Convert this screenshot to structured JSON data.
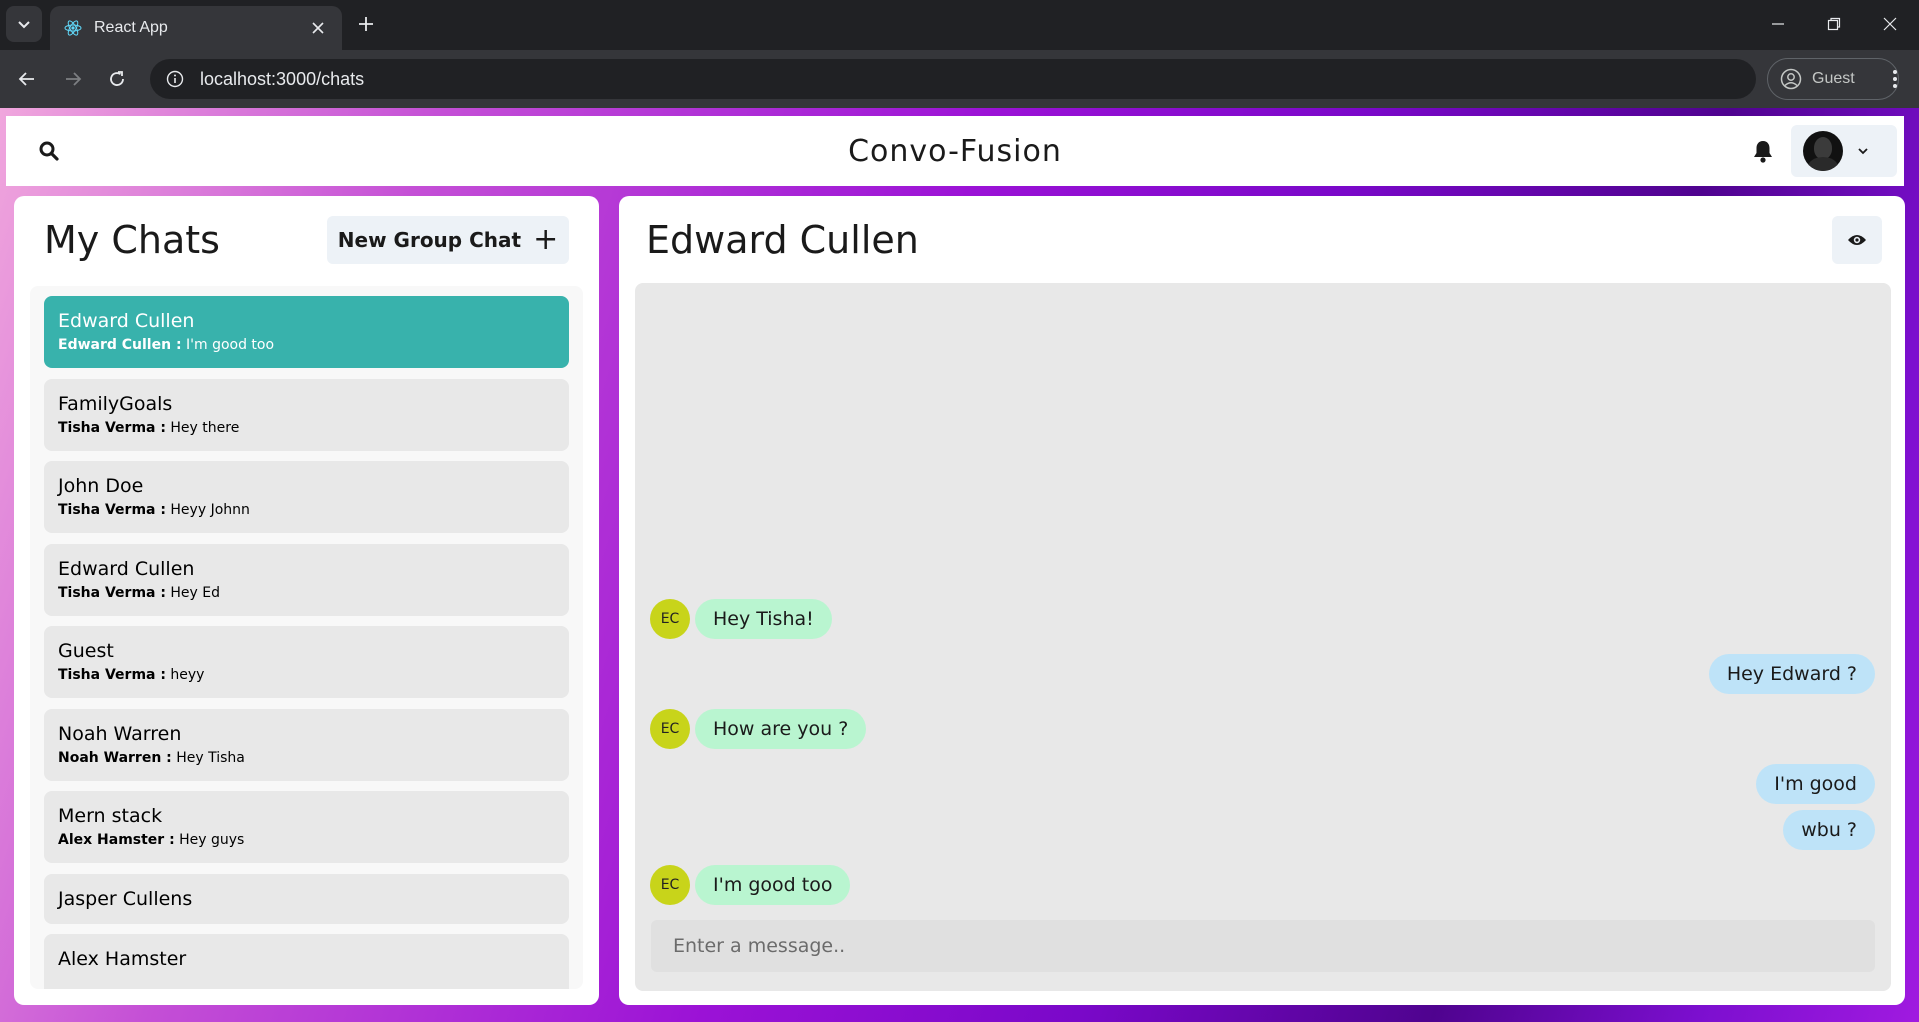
{
  "browser": {
    "tab_title": "React App",
    "url": "localhost:3000/chats",
    "profile_label": "Guest"
  },
  "app": {
    "title": "Convo-Fusion"
  },
  "sidebar": {
    "title": "My Chats",
    "new_group_label": "New Group Chat",
    "new_group_icon": "+",
    "chats": [
      {
        "name": "Edward Cullen",
        "sender": "Edward Cullen :",
        "message": "I'm good too",
        "active": true
      },
      {
        "name": "FamilyGoals",
        "sender": "Tisha Verma :",
        "message": "Hey there"
      },
      {
        "name": "John Doe",
        "sender": "Tisha Verma :",
        "message": "Heyy Johnn"
      },
      {
        "name": "Edward Cullen",
        "sender": "Tisha Verma :",
        "message": "Hey Ed"
      },
      {
        "name": "Guest",
        "sender": "Tisha Verma :",
        "message": "heyy"
      },
      {
        "name": "Noah Warren",
        "sender": "Noah Warren :",
        "message": "Hey Tisha"
      },
      {
        "name": "Mern stack",
        "sender": "Alex Hamster :",
        "message": "Hey guys"
      },
      {
        "name": "Jasper Cullens"
      },
      {
        "name": "Alex Hamster"
      }
    ]
  },
  "chat": {
    "title": "Edward Cullen",
    "messages": [
      {
        "text": "Hey Tisha!",
        "direction": "in",
        "avatar": "EC"
      },
      {
        "text": "Hey Edward ?",
        "direction": "out"
      },
      {
        "text": "How are you ?",
        "direction": "in",
        "avatar": "EC"
      },
      {
        "text": "I'm good",
        "direction": "out"
      },
      {
        "text": "wbu ?",
        "direction": "out"
      },
      {
        "text": "I'm good too",
        "direction": "in",
        "avatar": "EC"
      }
    ],
    "input_placeholder": "Enter a message..",
    "input_value": ""
  },
  "colors": {
    "active_chat": "#38b2ac",
    "incoming_bubble": "#b9f5d0",
    "outgoing_bubble": "#bee3f8",
    "avatar_bg": "#c8d41a"
  },
  "icons": [
    "chevron-down-icon",
    "react-icon",
    "close-icon",
    "plus-icon",
    "back-icon",
    "forward-icon",
    "reload-icon",
    "info-icon",
    "profile-icon",
    "kebab-menu-icon",
    "search-icon",
    "bell-icon",
    "eye-icon"
  ]
}
